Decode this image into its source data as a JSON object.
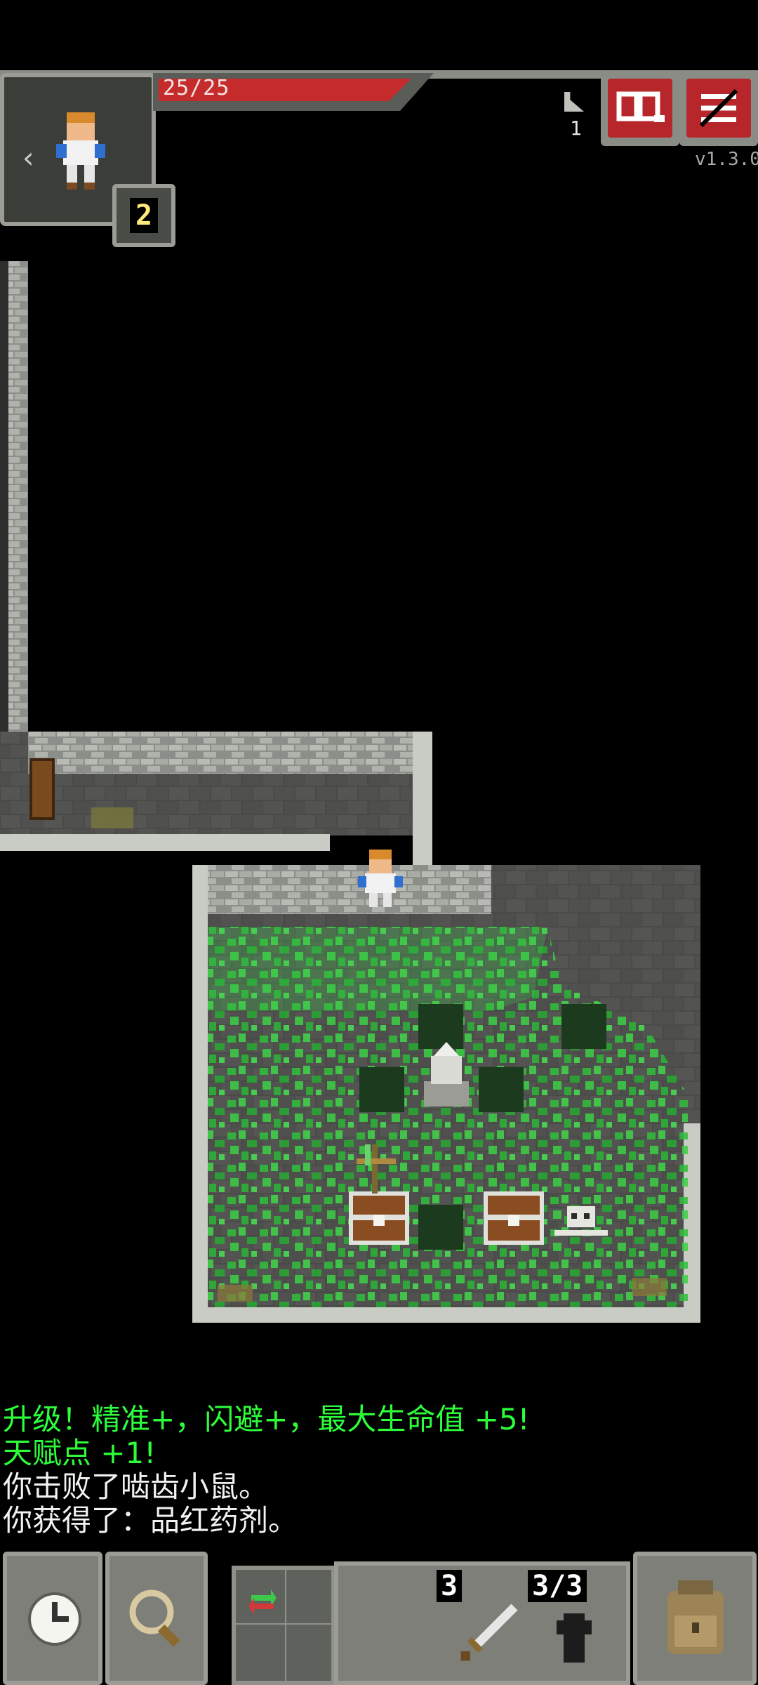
{
  "hud": {
    "hp_text": "25/25",
    "hp_fraction": 1.0,
    "hero_level": "2",
    "depth": "1",
    "version": "v1.3.0",
    "journal_icon": "journal-icon",
    "menu_icon": "menu-icon",
    "colors": {
      "hp": "#c62b2b",
      "button": "#b6262a"
    }
  },
  "log": [
    {
      "text": "升级！精准+，闪避+，最大生命值 +5!",
      "color": "#2cff3a"
    },
    {
      "text": "天赋点 +1!",
      "color": "#2cff3a"
    },
    {
      "text": "你击败了啮齿小鼠。",
      "color": "#f2f2f2"
    },
    {
      "text": "你获得了：品红药剂。",
      "color": "#f2f2f2"
    }
  ],
  "toolbar": {
    "wait_icon": "clock-icon",
    "search_icon": "magnifier-icon",
    "swap_icon": "swap-icon",
    "weapon_count": "3",
    "ammo_count": "3/3",
    "backpack_icon": "backpack-icon"
  }
}
